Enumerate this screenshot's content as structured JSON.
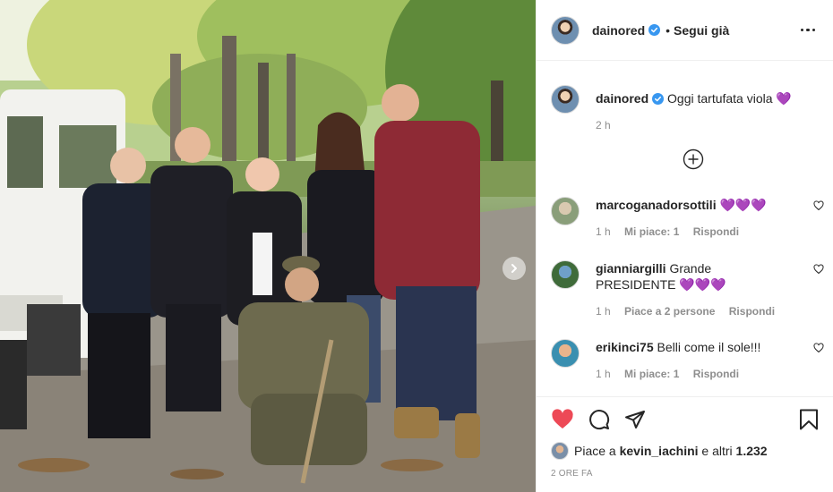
{
  "post": {
    "username": "dainored",
    "follow_text": "Segui già",
    "caption": "Oggi tartufata viola 💜",
    "caption_time": "2 h"
  },
  "comments": [
    {
      "username": "marcoganadorsottili",
      "text": "💜💜💜",
      "time": "1 h",
      "likes": "Mi piace: 1",
      "reply": "Rispondi"
    },
    {
      "username": "gianniargilli",
      "text": "Grande PRESIDENTE 💜💜💜",
      "time": "1 h",
      "likes": "Piace a 2 persone",
      "reply": "Rispondi"
    },
    {
      "username": "erikinci75",
      "text": "Belli come il sole!!!",
      "time": "1 h",
      "likes": "Mi piace: 1",
      "reply": "Rispondi"
    }
  ],
  "likes": {
    "prefix": "Piace a",
    "user": "kevin_iachini",
    "suffix": "e altri",
    "count": "1.232"
  },
  "timestamp": "2 ore fa",
  "icons": {
    "verified": "verified-badge-icon",
    "more": "more-options-icon",
    "load_more": "plus-circle-icon",
    "like": "heart-filled-icon",
    "comment": "comment-icon",
    "share": "share-icon",
    "save": "bookmark-icon",
    "next": "chevron-right-icon"
  },
  "colors": {
    "like": "#ed4956",
    "verified": "#3897f0",
    "meta": "#8e8e8e"
  }
}
